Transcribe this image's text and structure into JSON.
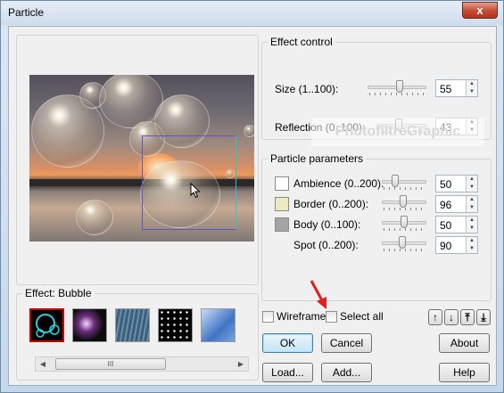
{
  "window": {
    "title": "Particle",
    "close_glyph": "x"
  },
  "preview": {
    "label": ""
  },
  "effect": {
    "title": "Effect: Bubble",
    "thumbnails": [
      {
        "name": "bubble",
        "selected": true
      },
      {
        "name": "sparkle",
        "selected": false
      },
      {
        "name": "rain",
        "selected": false
      },
      {
        "name": "snow",
        "selected": false
      },
      {
        "name": "clouds",
        "selected": false
      }
    ],
    "scrollbar_grip": "III"
  },
  "effect_control": {
    "title": "Effect control",
    "size_label": "Size (1..100):",
    "size_value": "55",
    "size_level": 0.55,
    "reflection_label": "Reflection (0..100):",
    "reflection_value": "43",
    "reflection_level": 0.43
  },
  "watermark": "PhotofiltreGraphic",
  "particle_params": {
    "title": "Particle parameters",
    "ambience_label": "Ambience (0..200):",
    "ambience_value": "50",
    "ambience_level": 0.25,
    "ambience_color": "#ffffff",
    "border_label": "Border (0..200):",
    "border_value": "96",
    "border_level": 0.48,
    "border_color": "#eee8c0",
    "body_label": "Body (0..100):",
    "body_value": "50",
    "body_level": 0.5,
    "body_color": "#a4a4a4",
    "spot_label": "Spot (0..200):",
    "spot_value": "90",
    "spot_level": 0.45
  },
  "options": {
    "wireframe_label": "Wireframe",
    "wireframe_checked": false,
    "select_all_label": "Select all",
    "select_all_checked": false
  },
  "order_buttons": [
    "↑",
    "↓",
    "⤒",
    "⤓"
  ],
  "buttons": {
    "ok": "OK",
    "cancel": "Cancel",
    "about": "About",
    "load": "Load...",
    "add": "Add...",
    "help": "Help"
  },
  "colors": {
    "selection": "#d00000",
    "annotation_arrow": "#e02020"
  }
}
